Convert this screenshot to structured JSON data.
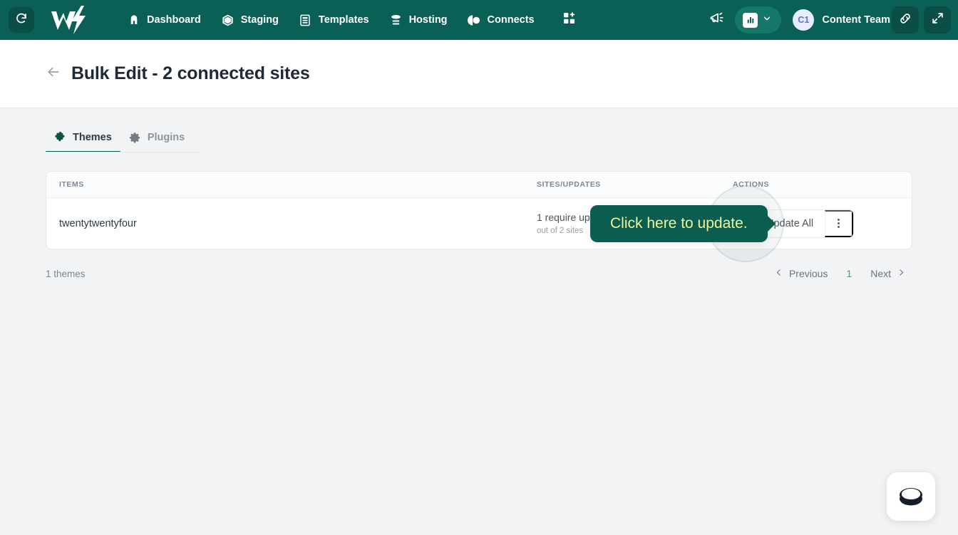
{
  "topnav": {
    "refresh_icon": "refresh-icon",
    "logo": "w-lightning-logo",
    "items": [
      {
        "label": "Dashboard",
        "icon": "home-icon"
      },
      {
        "label": "Staging",
        "icon": "cube-icon"
      },
      {
        "label": "Templates",
        "icon": "template-list-icon"
      },
      {
        "label": "Hosting",
        "icon": "server-icon"
      },
      {
        "label": "Connects",
        "icon": "contrast-circle-icon"
      }
    ],
    "grid_icon": "grid-plus-icon",
    "megaphone_icon": "megaphone-icon",
    "chart_pill_icon": "bar-chart-icon",
    "chart_pill_caret": "chevron-down-icon",
    "avatar_initials": "C1",
    "user_name": "Content Team",
    "link_icon": "link-icon",
    "expand_icon": "expand-arrows-icon",
    "colors": {
      "bar": "#0b6055",
      "pill": "#15766a",
      "square_btn": "#0a4e45"
    }
  },
  "titlebar": {
    "back_icon": "arrow-left-icon",
    "title": "Bulk Edit - 2 connected sites"
  },
  "tabs": [
    {
      "label": "Themes",
      "icon": "puzzle-piece-icon",
      "active": true
    },
    {
      "label": "Plugins",
      "icon": "gear-icon",
      "active": false
    }
  ],
  "table": {
    "headers": {
      "items": "ITEMS",
      "sites_updates": "SITES/UPDATES",
      "actions": "ACTIONS"
    },
    "rows": [
      {
        "name": "twentytwentyfour",
        "sites_main": "1 require update",
        "sites_sub": "out of 2 sites",
        "update_label": "Update All",
        "update_icon": "refresh-circle-icon",
        "kebab_icon": "kebab-menu-icon"
      }
    ]
  },
  "tooltip": {
    "text": "Click here to update.",
    "bg": "#0b5e4f",
    "fg": "#f2f299"
  },
  "footer": {
    "count_label": "1 themes",
    "previous_label": "Previous",
    "previous_icon": "chevron-left-icon",
    "current_page": "1",
    "next_label": "Next",
    "next_icon": "chevron-right-icon",
    "active_page_color": "#3fa17f"
  },
  "widget": {
    "icon": "bowl-logo-icon"
  }
}
